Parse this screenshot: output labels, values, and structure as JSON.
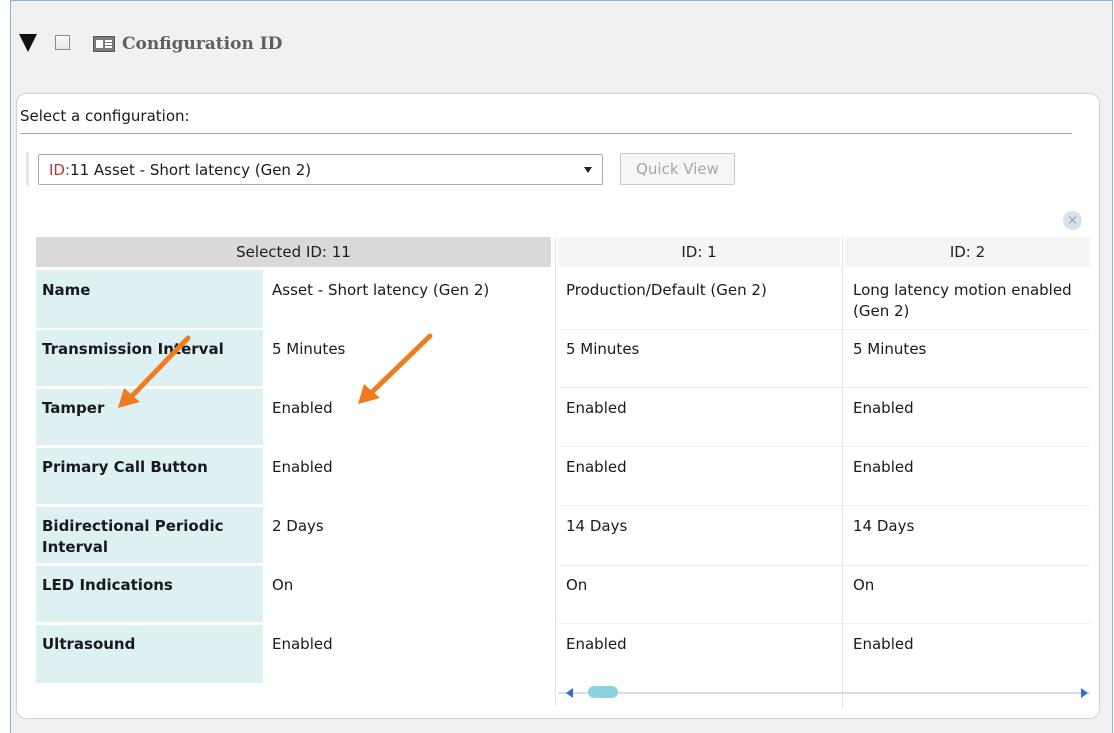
{
  "header": {
    "title": "Configuration ID",
    "icon": "config-icon"
  },
  "selector": {
    "label": "Select a configuration:",
    "selected_id_prefix": "ID:",
    "selected_value": "11 Asset - Short latency (Gen 2)",
    "quick_view_label": "Quick View"
  },
  "close_symbol": "×",
  "table": {
    "columns": [
      "Selected ID: 11",
      "ID: 1",
      "ID: 2"
    ],
    "rows": [
      {
        "label": "Name",
        "values": [
          "Asset - Short latency (Gen 2)",
          "Production/Default (Gen 2)",
          "Long latency motion enabled (Gen 2)"
        ]
      },
      {
        "label": "Transmission Interval",
        "values": [
          "5 Minutes",
          "5 Minutes",
          "5 Minutes"
        ]
      },
      {
        "label": "Tamper",
        "values": [
          "Enabled",
          "Enabled",
          "Enabled"
        ]
      },
      {
        "label": "Primary Call Button",
        "values": [
          "Enabled",
          "Enabled",
          "Enabled"
        ]
      },
      {
        "label": "Bidirectional Periodic Interval",
        "values": [
          "2 Days",
          "14 Days",
          "14 Days"
        ]
      },
      {
        "label": "LED Indications",
        "values": [
          "On",
          "On",
          "On"
        ]
      },
      {
        "label": "Ultrasound",
        "values": [
          "Enabled",
          "Enabled",
          "Enabled"
        ]
      }
    ]
  },
  "colors": {
    "accent_arrow": "#ef7d1f",
    "label_bg": "#ddf0f2",
    "id_prefix": "#b33b3b"
  }
}
